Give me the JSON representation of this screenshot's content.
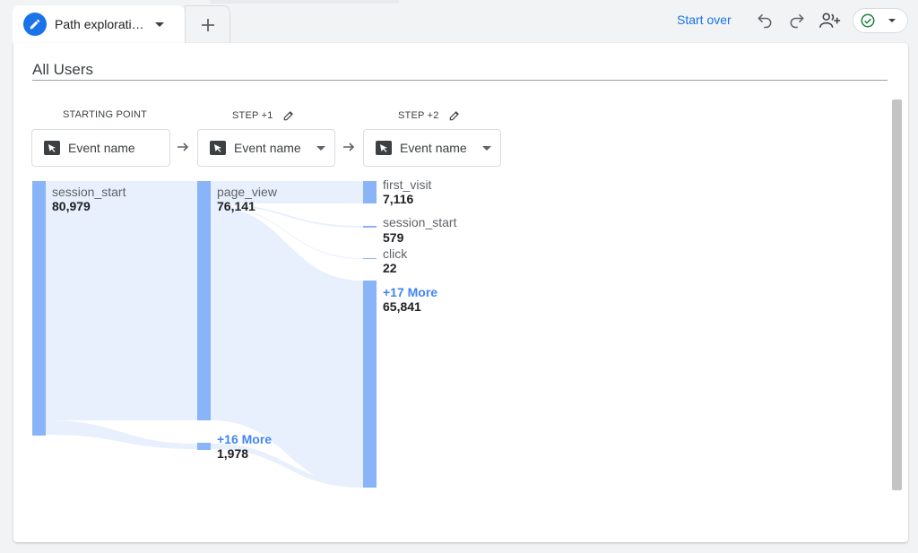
{
  "tab": {
    "title": "Path explorati…",
    "icon": "pencil-icon"
  },
  "toolbar": {
    "start_over": "Start over",
    "icons": [
      "undo-icon",
      "redo-icon",
      "share-users-icon",
      "check-circle-icon"
    ],
    "accent_color": "#1a73e8",
    "status_color": "#188038"
  },
  "segment": {
    "title": "All Users"
  },
  "steps": [
    {
      "header": "STARTING POINT",
      "selector_label": "Event name",
      "editable": false
    },
    {
      "header": "STEP +1",
      "selector_label": "Event name",
      "editable": true
    },
    {
      "header": "STEP +2",
      "selector_label": "Event name",
      "editable": true
    }
  ],
  "nodes": {
    "start": {
      "name": "session_start",
      "value": "80,979"
    },
    "step1": [
      {
        "name": "page_view",
        "value": "76,141"
      },
      {
        "more": "+16 More",
        "value": "1,978"
      }
    ],
    "step2": [
      {
        "name": "first_visit",
        "value": "7,116"
      },
      {
        "name": "session_start",
        "value": "579"
      },
      {
        "name": "click",
        "value": "22"
      },
      {
        "more": "+17 More",
        "value": "65,841"
      }
    ]
  },
  "colors": {
    "bar": "#8ab4f8",
    "flow": "#e8f0fe",
    "more_text": "#4285f4"
  }
}
